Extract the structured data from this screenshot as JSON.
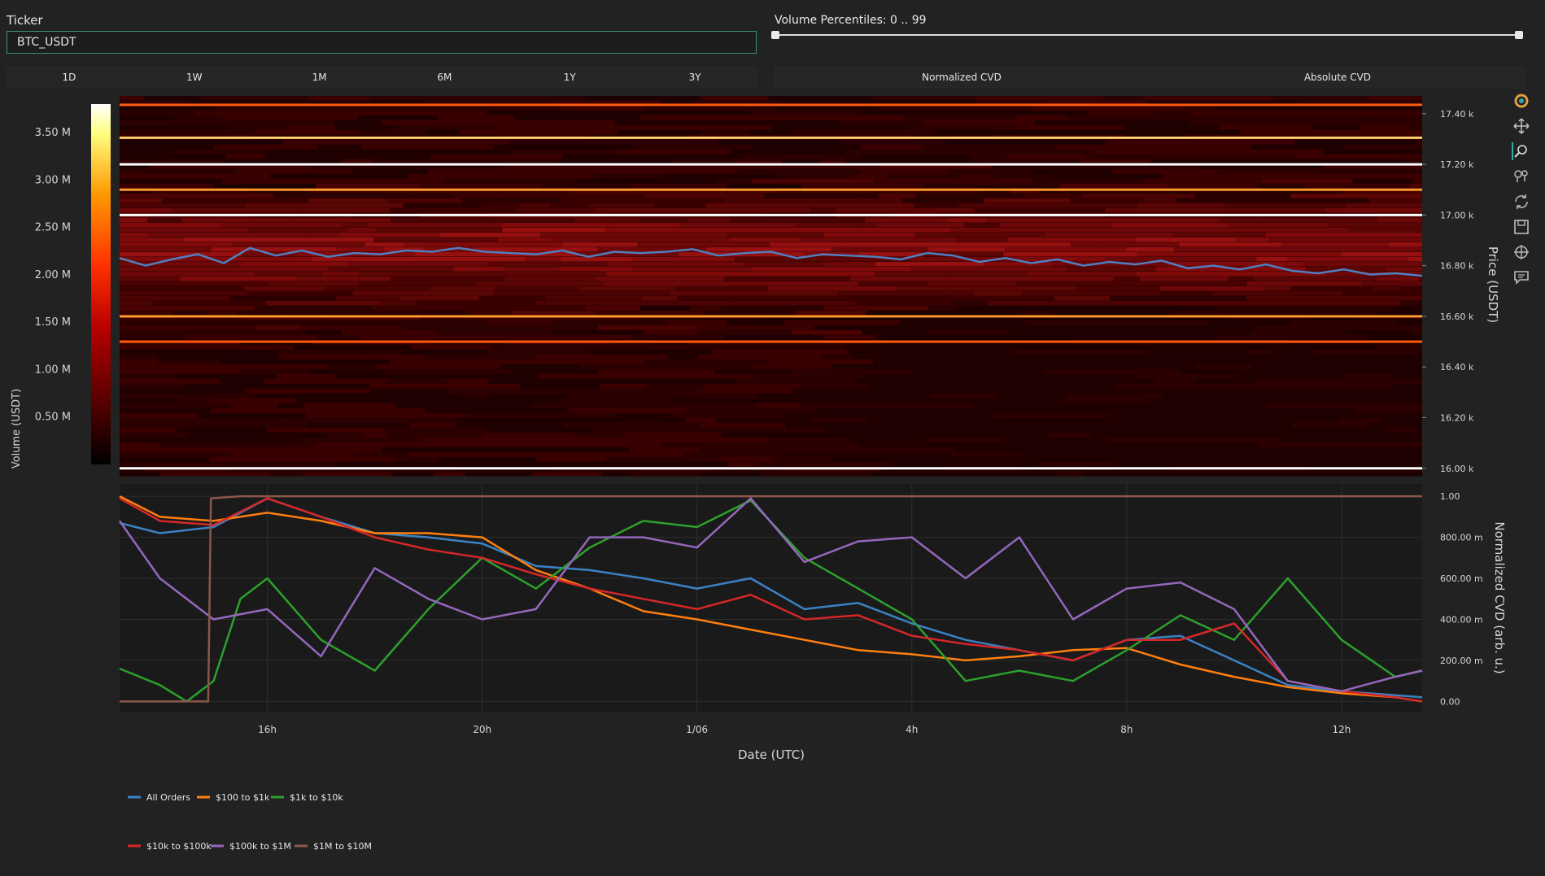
{
  "controls": {
    "ticker_label": "Ticker",
    "ticker_value": "BTC_USDT",
    "volume_label": "Volume Percentiles: 0 .. 99",
    "timeframe_tabs": [
      "1D",
      "1W",
      "1M",
      "6M",
      "1Y",
      "3Y"
    ],
    "cvd_tabs": [
      "Normalized CVD",
      "Absolute CVD"
    ]
  },
  "toolbar": [
    "plotly-logo-icon",
    "pan-icon",
    "box-zoom-icon",
    "zoom-tools-icon",
    "reset-icon",
    "save-icon",
    "crosshair-icon",
    "hover-icon"
  ],
  "chart_data": [
    {
      "type": "heatmap",
      "colorbar": {
        "label": "Volume (USDT)",
        "ticks": [
          "0.50 M",
          "1.00 M",
          "1.50 M",
          "2.00 M",
          "2.50 M",
          "3.00 M",
          "3.50 M"
        ],
        "tick_values": [
          0.5,
          1.0,
          1.5,
          2.0,
          2.5,
          3.0,
          3.5
        ],
        "range": [
          0,
          3.8
        ],
        "colors": [
          "#000000",
          "#5a0000",
          "#b80000",
          "#ff3000",
          "#ff9900",
          "#ffff80",
          "#ffffff"
        ]
      },
      "ylabel": "Price (USDT)",
      "y_ticks": [
        "16.00 k",
        "16.20 k",
        "16.40 k",
        "16.60 k",
        "16.80 k",
        "17.00 k",
        "17.20 k",
        "17.40 k"
      ],
      "y_tick_values": [
        16000,
        16200,
        16400,
        16600,
        16800,
        17000,
        17200,
        17400
      ],
      "ylim": [
        15980,
        17470
      ],
      "price_line": {
        "color": "#4f7fc0",
        "x": [
          0,
          0.02,
          0.04,
          0.06,
          0.08,
          0.1,
          0.12,
          0.14,
          0.16,
          0.18,
          0.2,
          0.22,
          0.24,
          0.26,
          0.28,
          0.3,
          0.32,
          0.34,
          0.36,
          0.38,
          0.4,
          0.42,
          0.44,
          0.46,
          0.48,
          0.5,
          0.52,
          0.54,
          0.56,
          0.58,
          0.6,
          0.62,
          0.64,
          0.66,
          0.68,
          0.7,
          0.72,
          0.74,
          0.76,
          0.78,
          0.8,
          0.82,
          0.84,
          0.86,
          0.88,
          0.9,
          0.92,
          0.94,
          0.96,
          0.98,
          1.0
        ],
        "values": [
          16830,
          16800,
          16825,
          16845,
          16810,
          16870,
          16840,
          16860,
          16835,
          16850,
          16845,
          16860,
          16855,
          16870,
          16855,
          16850,
          16845,
          16860,
          16835,
          16855,
          16850,
          16855,
          16865,
          16840,
          16850,
          16855,
          16830,
          16845,
          16840,
          16835,
          16825,
          16850,
          16840,
          16815,
          16830,
          16810,
          16825,
          16800,
          16815,
          16805,
          16820,
          16790,
          16800,
          16785,
          16805,
          16780,
          16770,
          16785,
          16765,
          16770,
          16760
        ]
      },
      "bright_levels": [
        {
          "price": 17435,
          "volume": 2.1
        },
        {
          "price": 17305,
          "volume": 2.9
        },
        {
          "price": 17200,
          "volume": 3.6
        },
        {
          "price": 17100,
          "volume": 2.6
        },
        {
          "price": 17000,
          "volume": 3.8
        },
        {
          "price": 16600,
          "volume": 2.4
        },
        {
          "price": 16500,
          "volume": 1.9
        },
        {
          "price": 16000,
          "volume": 3.8
        }
      ]
    },
    {
      "type": "line",
      "xlabel": "Date (UTC)",
      "ylabel": "Normalized CVD (arb. u.)",
      "x_ticks": [
        "16h",
        "20h",
        "1/06",
        "4h",
        "8h",
        "12h"
      ],
      "x_tick_values": [
        16,
        20,
        24,
        28,
        32,
        36
      ],
      "xlim": [
        13.25,
        37.5
      ],
      "y_ticks": [
        "0.00",
        "200.00 m",
        "400.00 m",
        "600.00 m",
        "800.00 m",
        "1.00"
      ],
      "y_tick_values": [
        0,
        0.2,
        0.4,
        0.6,
        0.8,
        1.0
      ],
      "ylim": [
        -0.05,
        1.06
      ],
      "series": [
        {
          "name": "All Orders",
          "color": "#3b82c4",
          "x": [
            13.25,
            14,
            15,
            16,
            17,
            18,
            19,
            20,
            21,
            22,
            23,
            24,
            25,
            26,
            27,
            28,
            29,
            30,
            31,
            32,
            33,
            34,
            35,
            36,
            37,
            37.5
          ],
          "values": [
            0.87,
            0.82,
            0.85,
            0.99,
            0.9,
            0.82,
            0.8,
            0.77,
            0.66,
            0.64,
            0.6,
            0.55,
            0.6,
            0.45,
            0.48,
            0.38,
            0.3,
            0.25,
            0.2,
            0.3,
            0.32,
            0.2,
            0.08,
            0.05,
            0.03,
            0.02
          ]
        },
        {
          "name": "$100 to $1k",
          "color": "#ff7f0e",
          "x": [
            13.25,
            14,
            15,
            16,
            17,
            18,
            19,
            20,
            21,
            22,
            23,
            24,
            25,
            26,
            27,
            28,
            29,
            30,
            31,
            32,
            33,
            34,
            35,
            36,
            37,
            37.5
          ],
          "values": [
            1.0,
            0.9,
            0.88,
            0.92,
            0.88,
            0.82,
            0.82,
            0.8,
            0.64,
            0.55,
            0.44,
            0.4,
            0.35,
            0.3,
            0.25,
            0.23,
            0.2,
            0.22,
            0.25,
            0.26,
            0.18,
            0.12,
            0.07,
            0.04,
            0.02,
            0.0
          ]
        },
        {
          "name": "$1k to $10k",
          "color": "#2ca02c",
          "x": [
            13.25,
            14,
            14.5,
            15,
            15.5,
            16,
            17,
            18,
            19,
            20,
            21,
            22,
            23,
            24,
            25,
            26,
            27,
            28,
            29,
            30,
            31,
            32,
            33,
            34,
            35,
            36,
            37,
            37.5
          ],
          "values": [
            0.16,
            0.08,
            0.0,
            0.1,
            0.5,
            0.6,
            0.3,
            0.15,
            0.45,
            0.7,
            0.55,
            0.75,
            0.88,
            0.85,
            0.98,
            0.7,
            0.55,
            0.4,
            0.1,
            0.15,
            0.1,
            0.25,
            0.42,
            0.3,
            0.6,
            0.3,
            0.12,
            0.15
          ]
        },
        {
          "name": "$10k to $100k",
          "color": "#d62728",
          "x": [
            13.25,
            14,
            15,
            16,
            17,
            18,
            19,
            20,
            21,
            22,
            23,
            24,
            25,
            26,
            27,
            28,
            29,
            30,
            31,
            32,
            33,
            34,
            35,
            36,
            37,
            37.5
          ],
          "values": [
            0.99,
            0.88,
            0.86,
            0.99,
            0.9,
            0.8,
            0.74,
            0.7,
            0.62,
            0.55,
            0.5,
            0.45,
            0.52,
            0.4,
            0.42,
            0.32,
            0.28,
            0.25,
            0.2,
            0.3,
            0.3,
            0.38,
            0.1,
            0.05,
            0.02,
            0.0
          ]
        },
        {
          "name": "$100k to $1M",
          "color": "#9467bd",
          "x": [
            13.25,
            14,
            15,
            16,
            17,
            18,
            19,
            20,
            21,
            22,
            23,
            24,
            25,
            26,
            27,
            28,
            29,
            30,
            31,
            32,
            33,
            34,
            35,
            36,
            37,
            37.5
          ],
          "values": [
            0.88,
            0.6,
            0.4,
            0.45,
            0.22,
            0.65,
            0.5,
            0.4,
            0.45,
            0.8,
            0.8,
            0.75,
            0.99,
            0.68,
            0.78,
            0.8,
            0.6,
            0.8,
            0.4,
            0.55,
            0.58,
            0.45,
            0.1,
            0.05,
            0.12,
            0.15
          ]
        },
        {
          "name": "$1M to $10M",
          "color": "#8c564b",
          "x": [
            13.25,
            14,
            14.9,
            14.95,
            15.5,
            16,
            20,
            24,
            28,
            32,
            36,
            37.5
          ],
          "values": [
            0.0,
            0.0,
            0.0,
            0.99,
            1.0,
            1.0,
            1.0,
            1.0,
            1.0,
            1.0,
            1.0,
            1.0
          ]
        }
      ]
    }
  ]
}
